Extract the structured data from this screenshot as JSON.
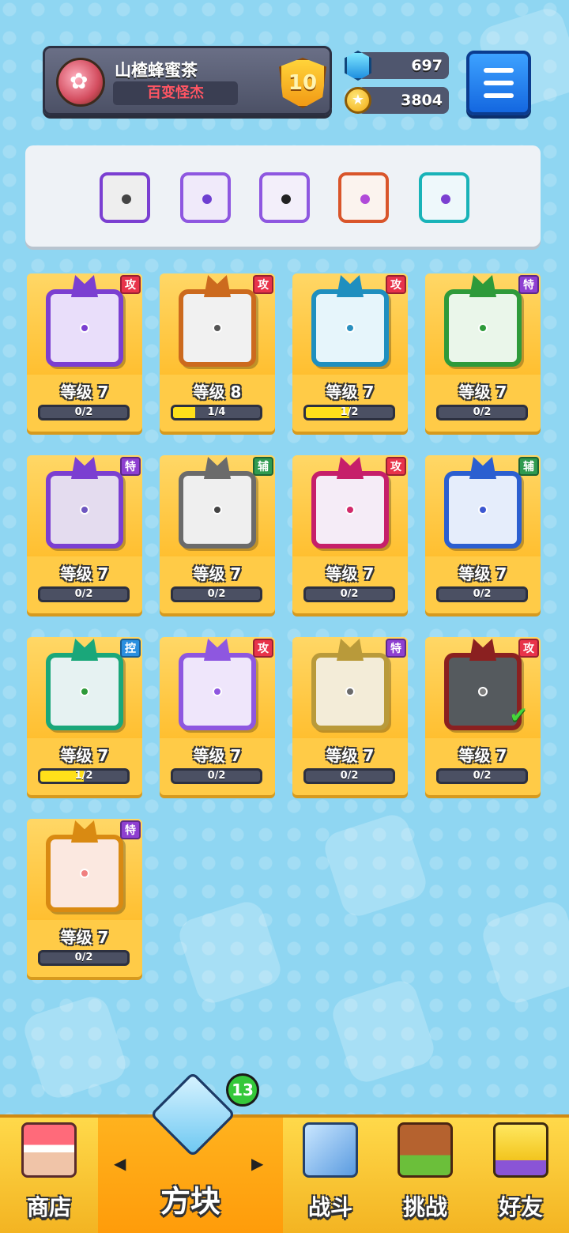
{
  "player": {
    "name": "山楂蜂蜜茶",
    "title": "百变怪杰",
    "rank": "10"
  },
  "currency": {
    "gems": "697",
    "coins": "3804"
  },
  "deck": {
    "dice": [
      {
        "icon": "saw-blade-die",
        "frame": "#7b3fd1"
      },
      {
        "icon": "gravity-die",
        "frame": "#8e57e0"
      },
      {
        "icon": "crack-die",
        "frame": "#8e57e0"
      },
      {
        "icon": "infinity-die",
        "frame": "#d9552a"
      },
      {
        "icon": "hands-die",
        "frame": "#19b3b8"
      }
    ]
  },
  "level_prefix": "等级",
  "dice": [
    {
      "level": "等级 7",
      "progress": "0/2",
      "ratio": 0.0,
      "tag": "攻",
      "tag_type": "attack",
      "frame": "#7b3fd1",
      "face": "#e9defa",
      "pip": "#7b3fd1",
      "icon": "orbit-die"
    },
    {
      "level": "等级 8",
      "progress": "1/4",
      "ratio": 0.25,
      "tag": "攻",
      "tag_type": "attack",
      "frame": "#cc6a1e",
      "face": "#f1f1f1",
      "pip": "#555",
      "icon": "gun-die"
    },
    {
      "level": "等级 7",
      "progress": "1/2",
      "ratio": 0.5,
      "tag": "攻",
      "tag_type": "attack",
      "frame": "#1f8fbf",
      "face": "#e6f5fb",
      "pip": "#2a8fbf",
      "icon": "whirlpool-die"
    },
    {
      "level": "等级 7",
      "progress": "0/2",
      "ratio": 0.0,
      "tag": "特",
      "tag_type": "special",
      "frame": "#2e9a3a",
      "face": "#eaf6ea",
      "pip": "#2e9a3a",
      "icon": "vine-die"
    },
    {
      "level": "等级 7",
      "progress": "0/2",
      "ratio": 0.0,
      "tag": "特",
      "tag_type": "special",
      "frame": "#7b3fd1",
      "face": "#e4dcef",
      "pip": "#6e56c0",
      "icon": "mist-die"
    },
    {
      "level": "等级 7",
      "progress": "0/2",
      "ratio": 0.0,
      "tag": "辅",
      "tag_type": "support",
      "frame": "#6b6b6b",
      "face": "#efefef",
      "pip": "#444",
      "icon": "timer-die"
    },
    {
      "level": "等级 7",
      "progress": "0/2",
      "ratio": 0.0,
      "tag": "攻",
      "tag_type": "attack",
      "frame": "#c61f6a",
      "face": "#f5ecf7",
      "pip": "#d12a6b",
      "icon": "combo-die"
    },
    {
      "level": "等级 7",
      "progress": "0/2",
      "ratio": 0.0,
      "tag": "辅",
      "tag_type": "support",
      "frame": "#2b5fd0",
      "face": "#e5edfb",
      "pip": "#3b57d1",
      "icon": "moon-die"
    },
    {
      "level": "等级 7",
      "progress": "1/2",
      "ratio": 0.5,
      "tag": "控",
      "tag_type": "control",
      "frame": "#1aa77a",
      "face": "#e6f2f2",
      "pip": "#2e9a3a",
      "icon": "wind-die"
    },
    {
      "level": "等级 7",
      "progress": "0/2",
      "ratio": 0.0,
      "tag": "攻",
      "tag_type": "attack",
      "frame": "#8e57e0",
      "face": "#efe6fb",
      "pip": "#8e57e0",
      "icon": "star-die"
    },
    {
      "level": "等级 7",
      "progress": "0/2",
      "ratio": 0.0,
      "tag": "特",
      "tag_type": "special",
      "frame": "#b99a3a",
      "face": "#f3ecd8",
      "pip": "#6b6b6b",
      "icon": "sun-die"
    },
    {
      "level": "等级 7",
      "progress": "0/2",
      "ratio": 0.0,
      "tag": "攻",
      "tag_type": "attack",
      "frame": "#8a2020",
      "face": "#555a5e",
      "pip": "#7c7c7c",
      "icon": "blackhole-die",
      "equipped": true
    },
    {
      "level": "等级 7",
      "progress": "0/2",
      "ratio": 0.0,
      "tag": "特",
      "tag_type": "special",
      "frame": "#d98a12",
      "face": "#fbe8e0",
      "pip": "#f08080",
      "icon": "heart-die"
    }
  ],
  "tag_colors": {
    "attack": "#e8334a",
    "special": "#8e3fd1",
    "support": "#2f9a4f",
    "control": "#2a8fe0"
  },
  "nav": {
    "shop": "商店",
    "dice": "方块",
    "dice_badge": "13",
    "battle": "战斗",
    "challenge": "挑战",
    "friends": "好友"
  }
}
